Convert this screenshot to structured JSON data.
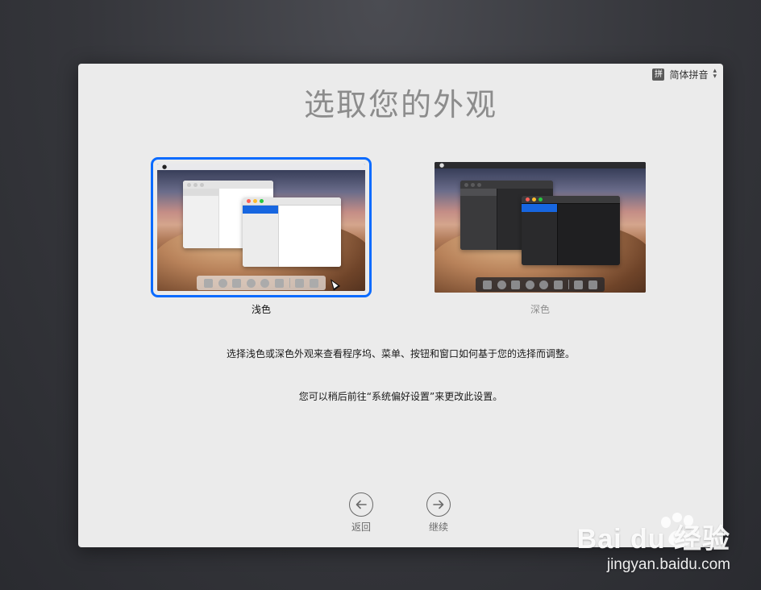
{
  "input_menu": {
    "badge": "拼",
    "label": "简体拼音"
  },
  "title": "选取您的外观",
  "appearances": {
    "light": {
      "label": "浅色",
      "selected": true
    },
    "dark": {
      "label": "深色",
      "selected": false
    }
  },
  "description": "选择浅色或深色外观来查看程序坞、菜单、按钮和窗口如何基于您的选择而调整。",
  "note": "您可以稍后前往“系统偏好设置”来更改此设置。",
  "nav": {
    "back_label": "返回",
    "continue_label": "继续"
  },
  "watermark": {
    "logo": "Bai du 经验",
    "url": "jingyan.baidu.com"
  },
  "colors": {
    "selection_accent": "#0a6bff",
    "dialog_bg": "#ebebeb",
    "title_gray": "#8c8c8c"
  }
}
